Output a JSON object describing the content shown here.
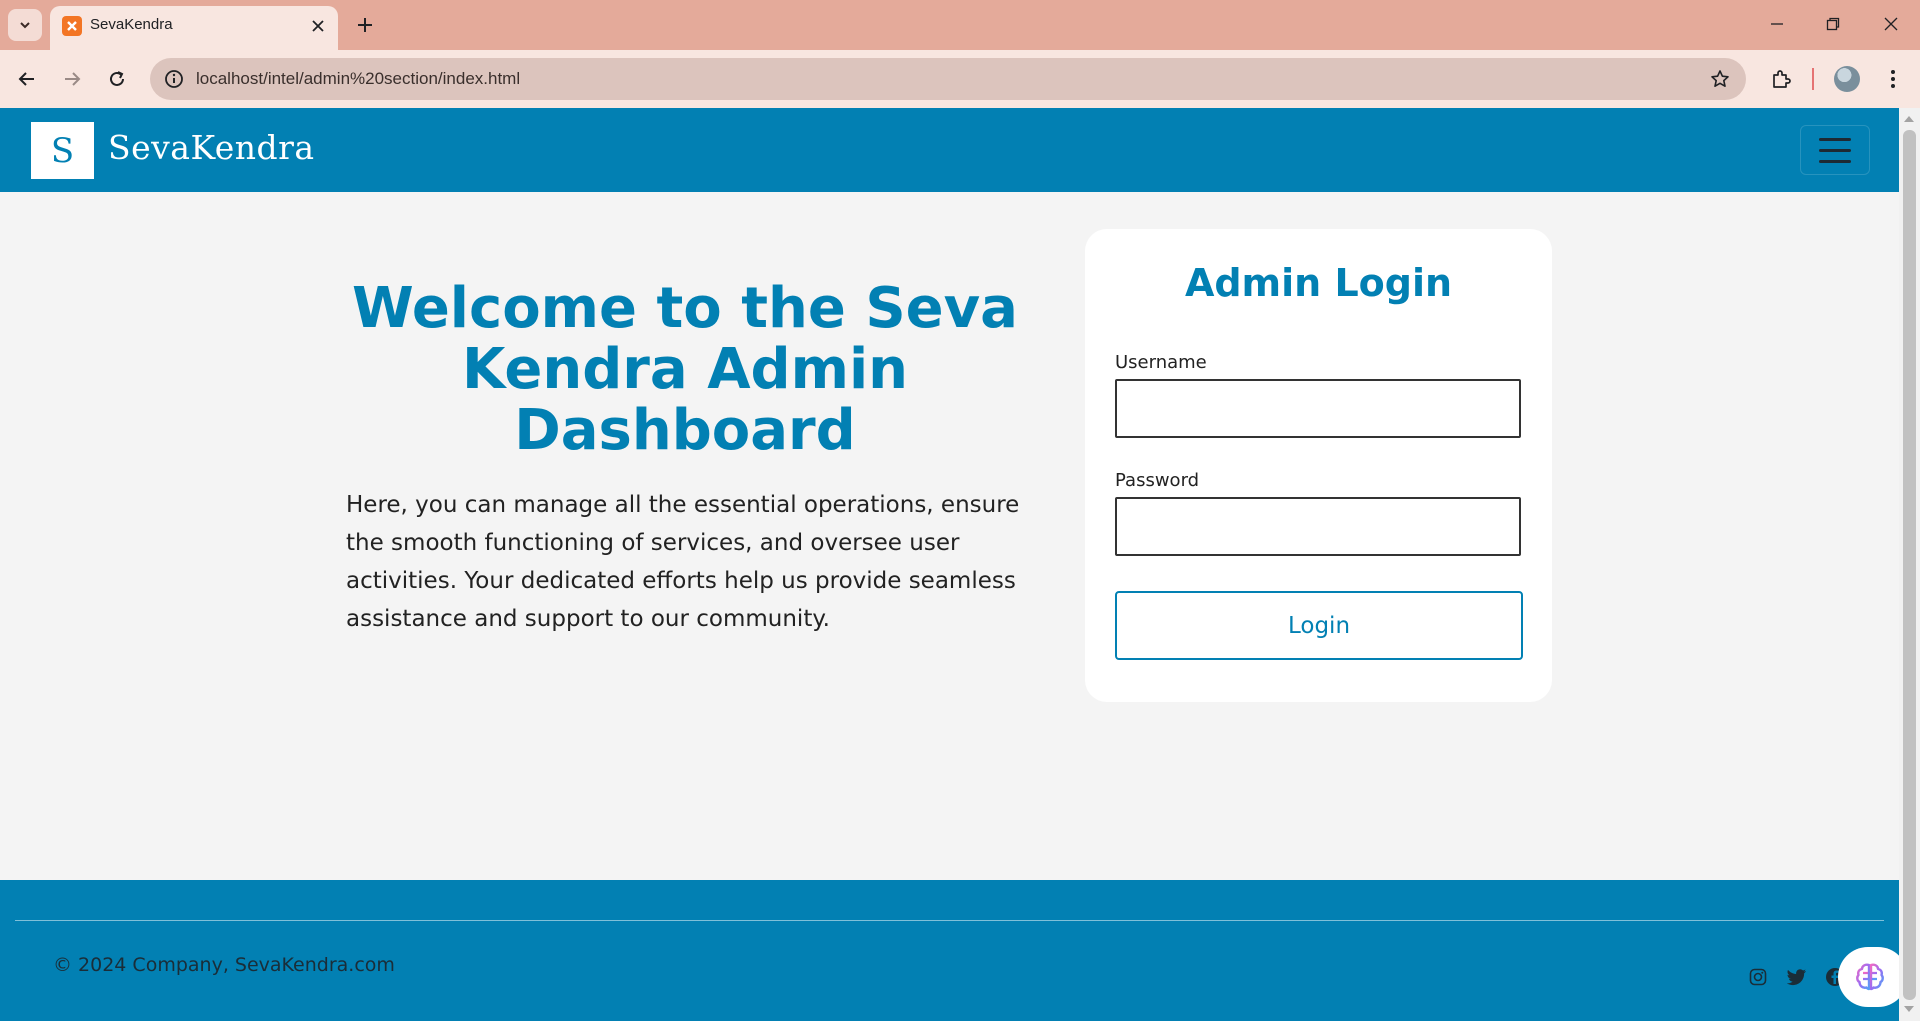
{
  "browser": {
    "tab_title": "SevaKendra",
    "url": "localhost/intel/admin%20section/index.html",
    "icons": {
      "tab_menu": "chevron-down-icon",
      "favicon": "xampp-icon",
      "tab_close": "close-icon",
      "new_tab": "plus-icon",
      "back": "arrow-left-icon",
      "forward": "arrow-right-icon",
      "reload": "reload-icon",
      "site_info": "info-icon",
      "bookmark": "star-icon",
      "extensions": "puzzle-icon",
      "menu": "more-vertical-icon"
    }
  },
  "navbar": {
    "logo_letter": "S",
    "brand": "SevaKendra"
  },
  "hero": {
    "title": "Welcome to the Seva Kendra Admin Dashboard",
    "text": "Here, you can manage all the essential operations, ensure the smooth functioning of services, and oversee user activities. Your dedicated efforts help us provide seamless assistance and support to our community."
  },
  "login": {
    "title": "Admin Login",
    "username_label": "Username",
    "username_value": "",
    "password_label": "Password",
    "password_value": "",
    "button_label": "Login"
  },
  "footer": {
    "copyright": "© 2024 Company, SevaKendra.com",
    "social": [
      "instagram-icon",
      "twitter-icon",
      "facebook-icon"
    ]
  },
  "colors": {
    "primary": "#0280b3",
    "page_background": "#f4f4f4",
    "tab_strip": "#e4aa9a"
  }
}
